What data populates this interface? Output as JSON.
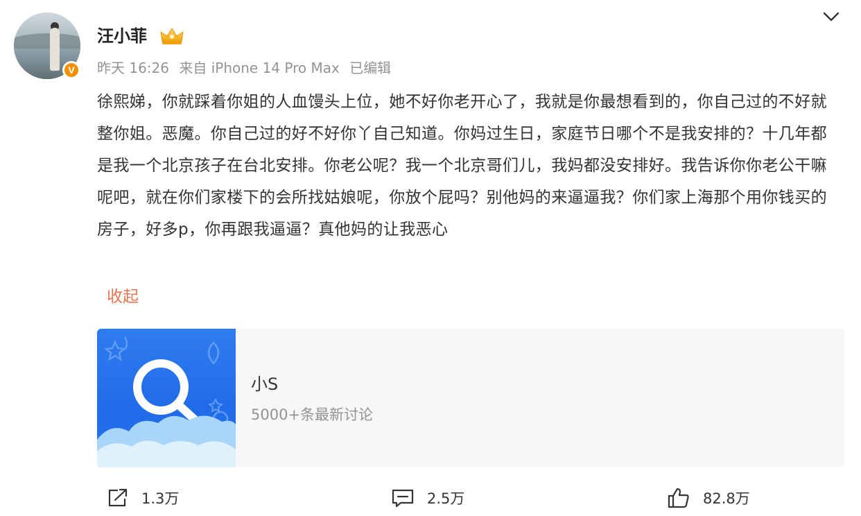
{
  "post": {
    "author": {
      "name": "汪小菲",
      "avatar_icon": "avatar-photo",
      "verified_icon": "verified-v-badge",
      "member_icon": "crown-icon"
    },
    "meta": {
      "time": "昨天 16:26",
      "source": "来自 iPhone 14 Pro Max",
      "edited": "已编辑"
    },
    "menu_icon": "chevron-down-icon",
    "text": "徐熙娣，你就踩着你姐的人血馒头上位，她不好你老开心了，我就是你最想看到的，你自己过的不好就整你姐。恶魔。你自己过的好不好你丫自己知道。你妈过生日，家庭节日哪个不是我安排的？十几年都是我一个北京孩子在台北安排。你老公呢？我一个北京哥们儿，我妈都没安排好。我告诉你你老公干嘛呢吧，就在你们家楼下的会所找姑娘呢，你放个屁吗？别他妈的来逼逼我？你们家上海那个用你钱买的房子，好多p，你再跟我逼逼？真他妈的让我恶心",
    "collapse_label": "收起",
    "topic_card": {
      "thumb_icon": "search-icon",
      "title": "小S",
      "subtitle": "5000+条最新讨论"
    },
    "actions": {
      "share": {
        "icon": "share-icon",
        "count": "1.3万"
      },
      "comment": {
        "icon": "comment-icon",
        "count": "2.5万"
      },
      "like": {
        "icon": "thumbs-up-icon",
        "count": "82.8万"
      }
    }
  },
  "colors": {
    "link": "#eb7350",
    "meta": "#939393",
    "verified": "#f29100",
    "card_bg": "#f7f7f7",
    "thumb_blue": "#2f7cf0"
  }
}
